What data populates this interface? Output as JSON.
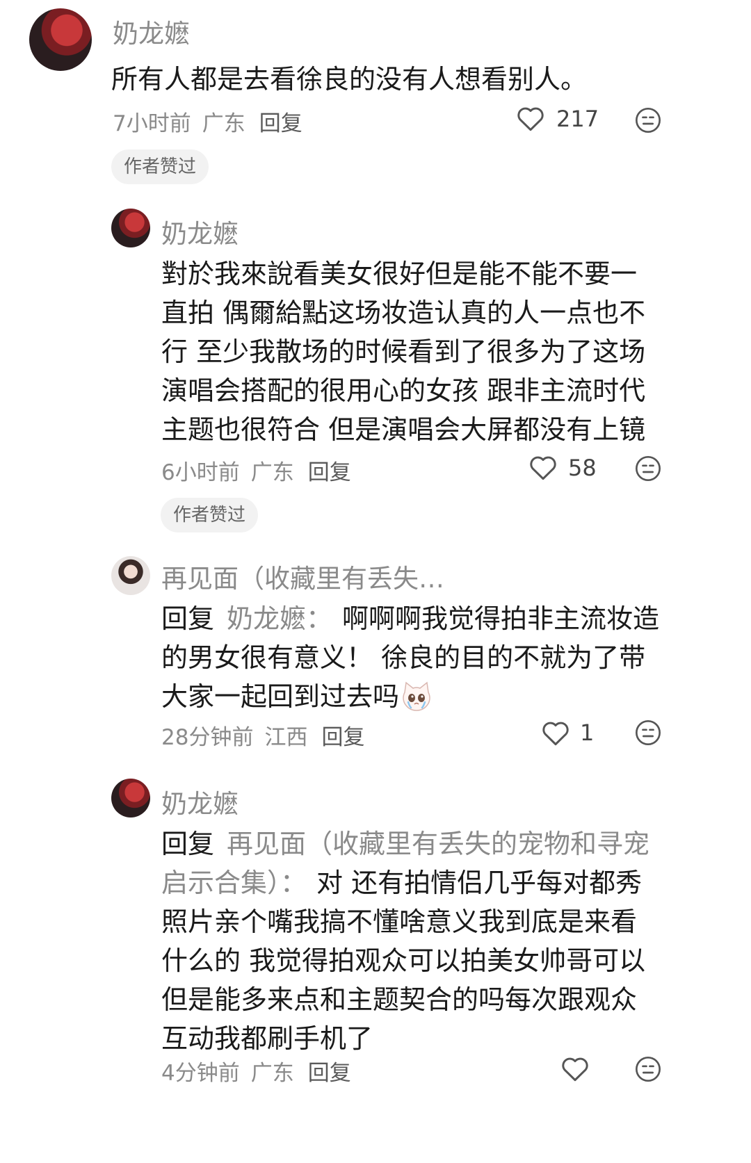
{
  "comments": [
    {
      "username": "奶龙嬷",
      "text": "所有人都是去看徐良的没有人想看别人。",
      "time": "7小时前",
      "location": "广东",
      "reply_label": "回复",
      "likes": "217",
      "tag": "作者赞过"
    },
    {
      "username": "奶龙嬷",
      "lines": [
        "對於我來說看美女很好但是能不能不要一",
        "直拍 偶爾給點这场妆造认真的人一点也不",
        "行 至少我散场的时候看到了很多为了这场",
        "演唱会搭配的很用心的女孩 跟非主流时代",
        "主题也很符合 但是演唱会大屏都没有上镜"
      ],
      "time": "6小时前",
      "location": "广东",
      "reply_label": "回复",
      "likes": "58",
      "tag": "作者赞过"
    },
    {
      "username": "再见面（收藏里有丢失…",
      "reply_word": "回复",
      "reply_to": "奶龙嬷：",
      "lines": [
        "啊啊啊我觉得拍非主流妆造",
        "的男女很有意义！ 徐良的目的不就为了带",
        "大家一起回到过去吗"
      ],
      "emoji": "crying-cat-emoji",
      "time": "28分钟前",
      "location": "江西",
      "reply_label": "回复",
      "likes": "1"
    },
    {
      "username": "奶龙嬷",
      "reply_word": "回复",
      "reply_to_line1": "再见面（收藏里有丢失的宠物和寻宠",
      "reply_to_line2": "启示合集）：",
      "lines": [
        "对 还有拍情侣几乎每对都秀",
        "照片亲个嘴我搞不懂啥意义我到底是来看",
        "什么的 我觉得拍观众可以拍美女帅哥可以",
        "但是能多来点和主题契合的吗每次跟观众",
        "互动我都刷手机了"
      ],
      "time": "4分钟前",
      "location": "广东",
      "reply_label": "回复",
      "likes": ""
    }
  ],
  "icons": {
    "like": "heart-outline-icon",
    "react": "neutral-face-icon"
  }
}
